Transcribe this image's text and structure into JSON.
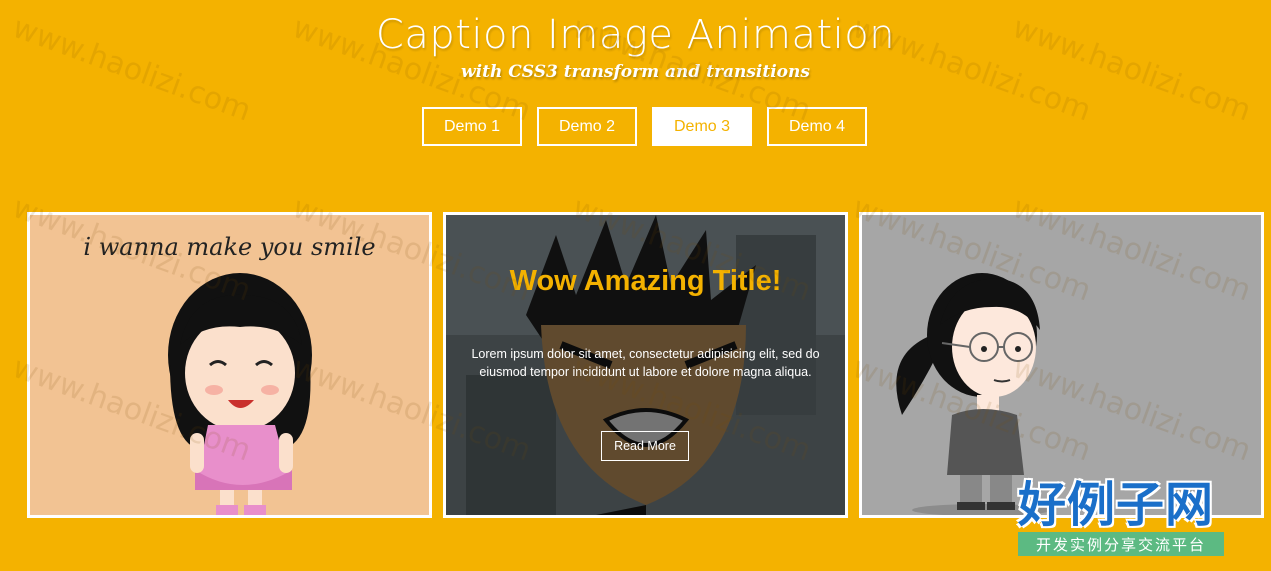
{
  "header": {
    "title": "Caption Image Animation",
    "subtitle": "with CSS3 transform and transitions"
  },
  "nav": {
    "items": [
      {
        "label": "Demo 1",
        "active": false
      },
      {
        "label": "Demo 2",
        "active": false
      },
      {
        "label": "Demo 3",
        "active": true
      },
      {
        "label": "Demo 4",
        "active": false
      }
    ]
  },
  "gallery": {
    "card1": {
      "image_text": "i wanna make you smile"
    },
    "card2": {
      "caption_title": "Wow Amazing Title!",
      "caption_text": "Lorem ipsum dolor sit amet, consectetur adipisicing elit, sed do eiusmod tempor incididunt ut labore et dolore magna aliqua.",
      "button_label": "Read More"
    }
  },
  "watermark": {
    "text": "www.haolizi.com"
  },
  "logo": {
    "main": "好例子网",
    "sub": "开发实例分享交流平台"
  },
  "colors": {
    "background": "#f4b200",
    "accent": "#f4b200",
    "text": "#ffffff",
    "logo_blue": "#1a6fc9",
    "logo_green": "#5cba82"
  }
}
